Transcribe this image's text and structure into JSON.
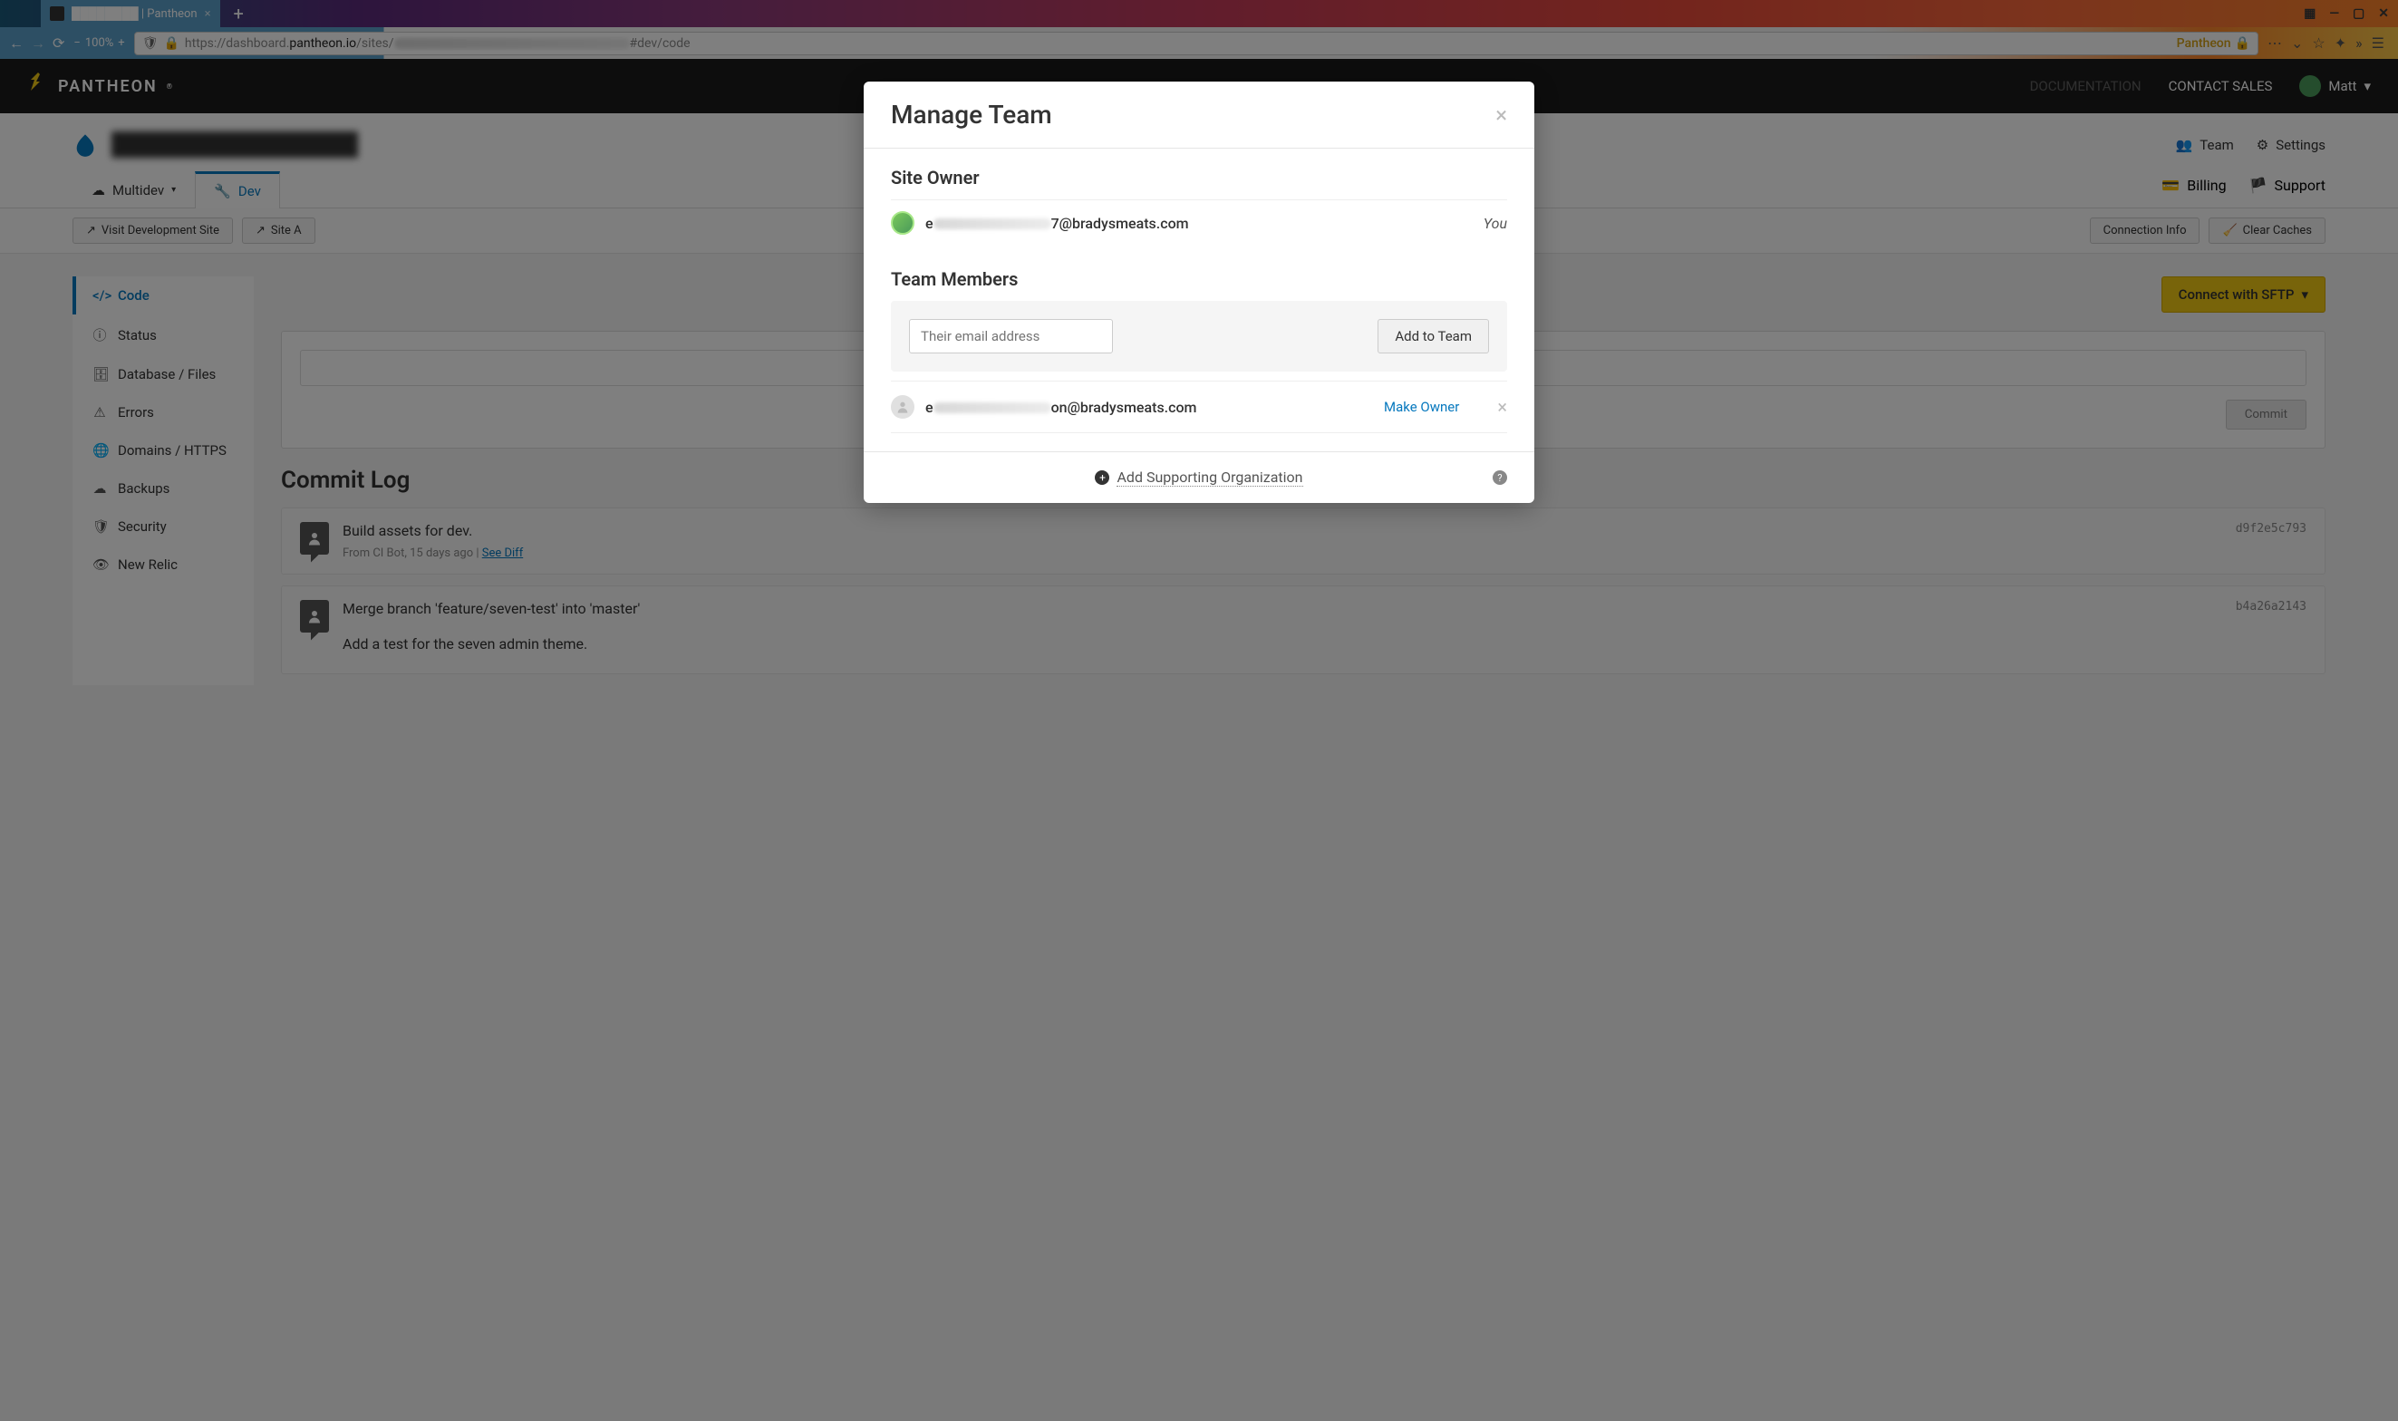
{
  "browser": {
    "tab_title": "████████ | Pantheon",
    "url_prefix": "https://dashboard.",
    "url_domain": "pantheon.io",
    "url_path_start": "/sites/",
    "url_path_end": "#dev/code",
    "zoom": "100%",
    "pantheon_badge": "Pantheon"
  },
  "topnav": {
    "logo": "PANTHEON",
    "docs": "DOCUMENTATION",
    "contact": "CONTACT SALES",
    "user": "Matt"
  },
  "site": {
    "name_blurred": "████████████████",
    "actions": {
      "team": "Team",
      "settings": "Settings",
      "billing": "Billing",
      "support": "Support"
    },
    "tabs": {
      "multidev": "Multidev",
      "dev": "Dev"
    },
    "toolbar": {
      "visit": "Visit Development Site",
      "site_admin": "Site A",
      "connection_info": "Connection Info",
      "clear_caches": "Clear Caches"
    }
  },
  "sidebar": {
    "items": [
      {
        "label": "Code"
      },
      {
        "label": "Status"
      },
      {
        "label": "Database / Files"
      },
      {
        "label": "Errors"
      },
      {
        "label": "Domains / HTTPS"
      },
      {
        "label": "Backups"
      },
      {
        "label": "Security"
      },
      {
        "label": "New Relic"
      }
    ]
  },
  "content": {
    "connect_sftp": "Connect with SFTP",
    "commit_btn": "Commit",
    "commit_log_title": "Commit Log",
    "commits": [
      {
        "msg": "Build assets for dev.",
        "meta_from": "From CI Bot, 15 days ago",
        "see_diff": "See Diff",
        "hash": "d9f2e5c793"
      },
      {
        "msg": "Merge branch 'feature/seven-test' into 'master'",
        "meta_from": "",
        "see_diff": "",
        "hash": "b4a26a2143",
        "msg2": "Add a test for the seven admin theme."
      }
    ]
  },
  "modal": {
    "title": "Manage Team",
    "site_owner_title": "Site Owner",
    "owner_email_suffix": "7@bradysmeats.com",
    "you": "You",
    "team_members_title": "Team Members",
    "email_placeholder": "Their email address",
    "add_btn": "Add to Team",
    "member_email_suffix": "on@bradysmeats.com",
    "make_owner": "Make Owner",
    "add_org": "Add Supporting Organization"
  }
}
